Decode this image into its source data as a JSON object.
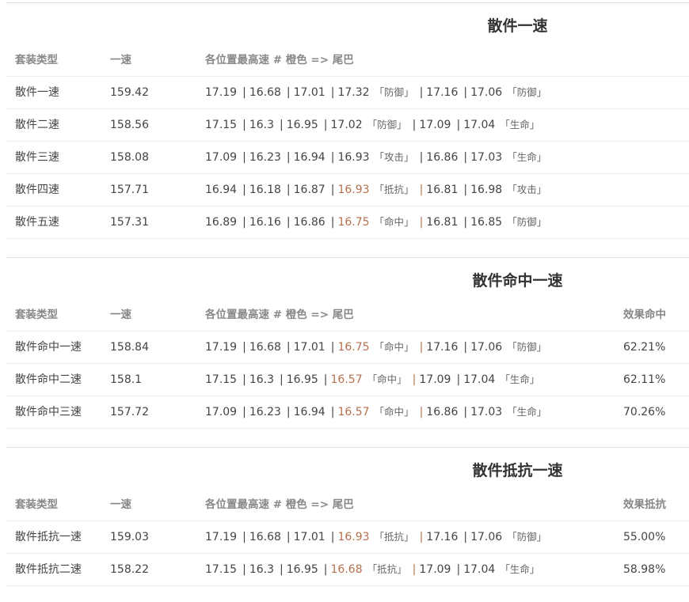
{
  "tables": [
    {
      "title": "散件一速",
      "headers": {
        "type": "套装类型",
        "speed": "一速",
        "positions": "各位置最高速 # 橙色 => 尾巴",
        "extra": ""
      },
      "rows": [
        {
          "type": "散件一速",
          "speed": "159.42",
          "values": [
            "17.19",
            "16.68",
            "17.01",
            "17.32",
            "17.16",
            "17.06"
          ],
          "tag4": "防御",
          "tag6": "防御",
          "orange": false,
          "extra": ""
        },
        {
          "type": "散件二速",
          "speed": "158.56",
          "values": [
            "17.15",
            "16.3",
            "16.95",
            "17.02",
            "17.09",
            "17.04"
          ],
          "tag4": "防御",
          "tag6": "生命",
          "orange": false,
          "extra": ""
        },
        {
          "type": "散件三速",
          "speed": "158.08",
          "values": [
            "17.09",
            "16.23",
            "16.94",
            "16.93",
            "16.86",
            "17.03"
          ],
          "tag4": "攻击",
          "tag6": "生命",
          "orange": false,
          "extra": ""
        },
        {
          "type": "散件四速",
          "speed": "157.71",
          "values": [
            "16.94",
            "16.18",
            "16.87",
            "16.93",
            "16.81",
            "16.98"
          ],
          "tag4": "抵抗",
          "tag6": "攻击",
          "orange": true,
          "extra": ""
        },
        {
          "type": "散件五速",
          "speed": "157.31",
          "values": [
            "16.89",
            "16.16",
            "16.86",
            "16.75",
            "16.81",
            "16.85"
          ],
          "tag4": "命中",
          "tag6": "防御",
          "orange": true,
          "extra": ""
        }
      ]
    },
    {
      "title": "散件命中一速",
      "headers": {
        "type": "套装类型",
        "speed": "一速",
        "positions": "各位置最高速 # 橙色 => 尾巴",
        "extra": "效果命中"
      },
      "rows": [
        {
          "type": "散件命中一速",
          "speed": "158.84",
          "values": [
            "17.19",
            "16.68",
            "17.01",
            "16.75",
            "17.16",
            "17.06"
          ],
          "tag4": "命中",
          "tag6": "防御",
          "orange": true,
          "extra": "62.21%"
        },
        {
          "type": "散件命中二速",
          "speed": "158.1",
          "values": [
            "17.15",
            "16.3",
            "16.95",
            "16.57",
            "17.09",
            "17.04"
          ],
          "tag4": "命中",
          "tag6": "生命",
          "orange": true,
          "extra": "62.11%"
        },
        {
          "type": "散件命中三速",
          "speed": "157.72",
          "values": [
            "17.09",
            "16.23",
            "16.94",
            "16.57",
            "16.86",
            "17.03"
          ],
          "tag4": "命中",
          "tag6": "生命",
          "orange": true,
          "extra": "70.26%"
        }
      ]
    },
    {
      "title": "散件抵抗一速",
      "headers": {
        "type": "套装类型",
        "speed": "一速",
        "positions": "各位置最高速 # 橙色 => 尾巴",
        "extra": "效果抵抗"
      },
      "rows": [
        {
          "type": "散件抵抗一速",
          "speed": "159.03",
          "values": [
            "17.19",
            "16.68",
            "17.01",
            "16.93",
            "17.16",
            "17.06"
          ],
          "tag4": "抵抗",
          "tag6": "防御",
          "orange": true,
          "extra": "55.00%"
        },
        {
          "type": "散件抵抗二速",
          "speed": "158.22",
          "values": [
            "17.15",
            "16.3",
            "16.95",
            "16.68",
            "17.09",
            "17.04"
          ],
          "tag4": "抵抗",
          "tag6": "生命",
          "orange": true,
          "extra": "58.98%"
        }
      ]
    }
  ],
  "colors": {
    "orange": "#b5714d",
    "text": "#444444",
    "header": "#888888",
    "border": "#ececec"
  }
}
